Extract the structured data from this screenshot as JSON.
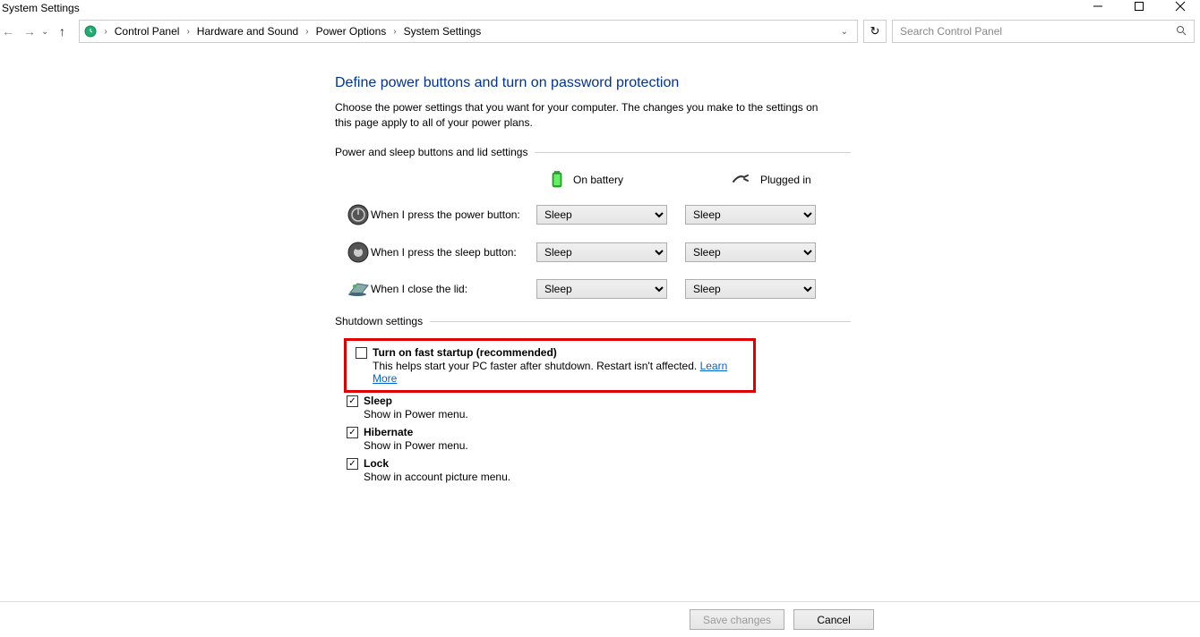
{
  "window": {
    "title": "System Settings"
  },
  "breadcrumb": {
    "items": [
      "Control Panel",
      "Hardware and Sound",
      "Power Options",
      "System Settings"
    ]
  },
  "search": {
    "placeholder": "Search Control Panel"
  },
  "heading": "Define power buttons and turn on password protection",
  "description": "Choose the power settings that you want for your computer. The changes you make to the settings on this page apply to all of your power plans.",
  "section1": {
    "title": "Power and sleep buttons and lid settings",
    "col_battery": "On battery",
    "col_plugged": "Plugged in",
    "rows": [
      {
        "label": "When I press the power button:",
        "battery": "Sleep",
        "plugged": "Sleep"
      },
      {
        "label": "When I press the sleep button:",
        "battery": "Sleep",
        "plugged": "Sleep"
      },
      {
        "label": "When I close the lid:",
        "battery": "Sleep",
        "plugged": "Sleep"
      }
    ]
  },
  "section2": {
    "title": "Shutdown settings",
    "items": [
      {
        "label": "Turn on fast startup (recommended)",
        "desc": "This helps start your PC faster after shutdown. Restart isn't affected. ",
        "link": "Learn More",
        "checked": false
      },
      {
        "label": "Sleep",
        "desc": "Show in Power menu.",
        "checked": true
      },
      {
        "label": "Hibernate",
        "desc": "Show in Power menu.",
        "checked": true
      },
      {
        "label": "Lock",
        "desc": "Show in account picture menu.",
        "checked": true
      }
    ]
  },
  "footer": {
    "save": "Save changes",
    "cancel": "Cancel"
  }
}
